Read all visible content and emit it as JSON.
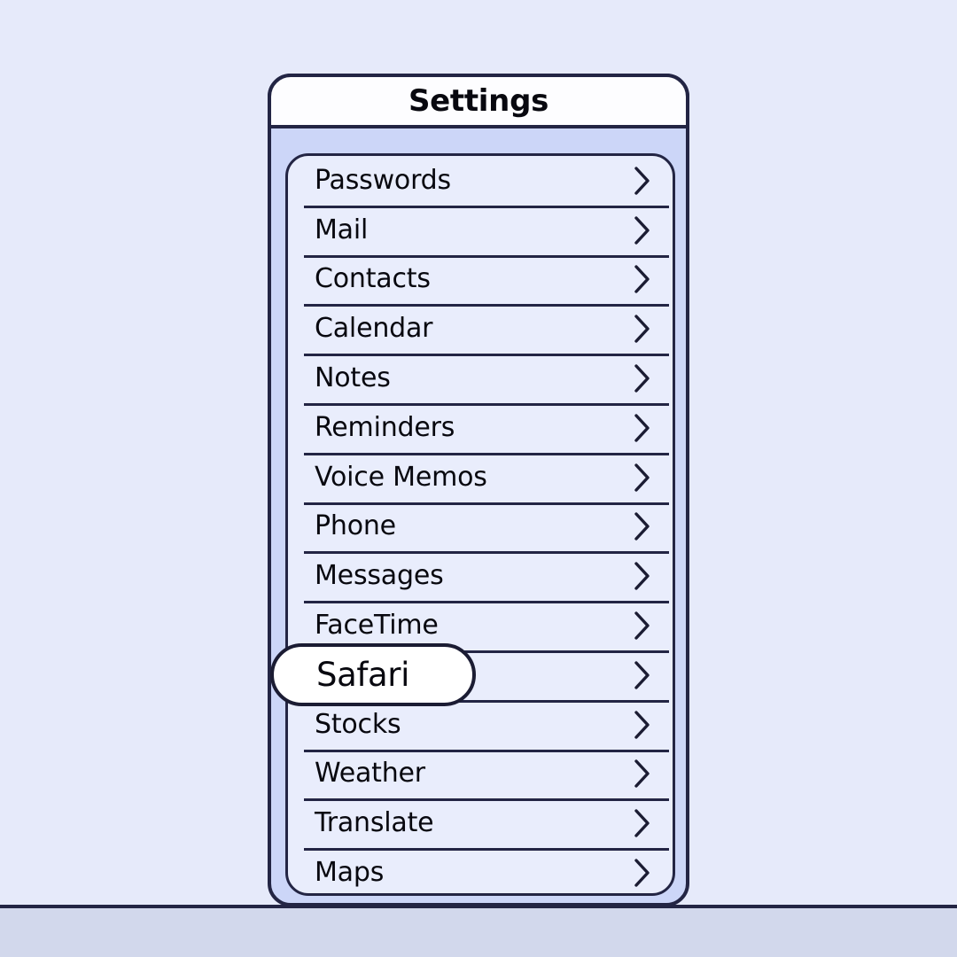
{
  "colors": {
    "wall": "#E6EAFA",
    "floor": "#D2D8EC",
    "phone_body": "#CCD6F8",
    "card_fill": "#E9EDFC",
    "header_fill": "#FDFDFF",
    "outline": "#232544",
    "text": "#08080F",
    "highlight_fill": "#FFFFFF"
  },
  "scene": {
    "horizon_name": "ground-line"
  },
  "phone": {
    "header": {
      "title": "Settings"
    },
    "settings_list": {
      "chevron_icon": "chevron-right-icon",
      "selected_item": "Safari",
      "items": [
        {
          "label": "Passwords",
          "selected": false
        },
        {
          "label": "Mail",
          "selected": false
        },
        {
          "label": "Contacts",
          "selected": false
        },
        {
          "label": "Calendar",
          "selected": false
        },
        {
          "label": "Notes",
          "selected": false
        },
        {
          "label": "Reminders",
          "selected": false
        },
        {
          "label": "Voice Memos",
          "selected": false
        },
        {
          "label": "Phone",
          "selected": false
        },
        {
          "label": "Messages",
          "selected": false
        },
        {
          "label": "FaceTime",
          "selected": false
        },
        {
          "label": "Safari",
          "selected": true
        },
        {
          "label": "Stocks",
          "selected": false
        },
        {
          "label": "Weather",
          "selected": false
        },
        {
          "label": "Translate",
          "selected": false
        },
        {
          "label": "Maps",
          "selected": false
        }
      ]
    }
  }
}
